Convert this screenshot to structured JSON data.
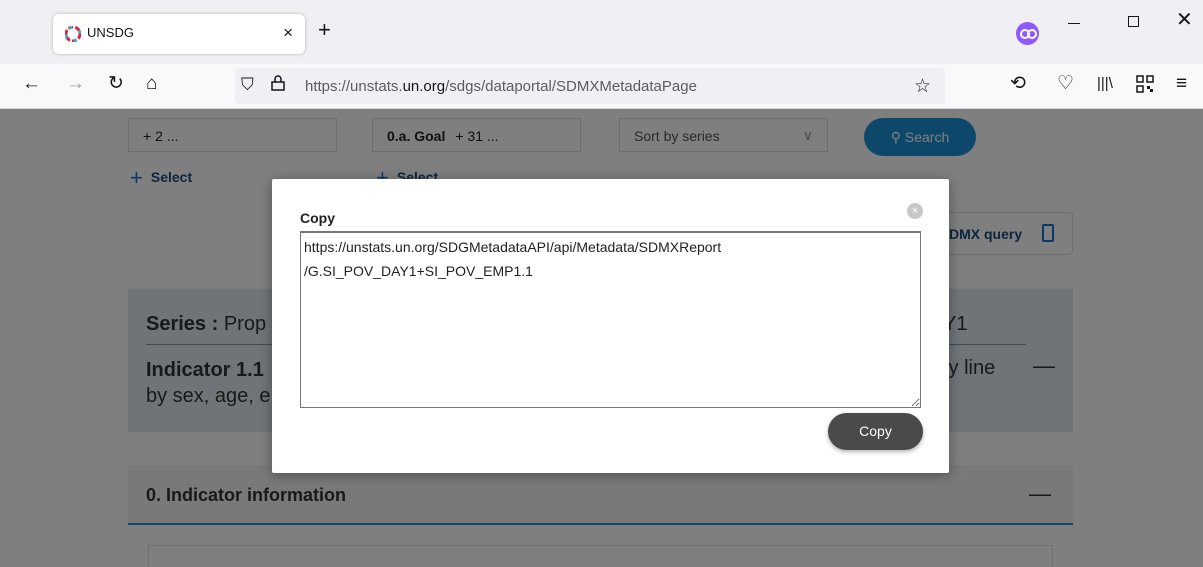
{
  "browser": {
    "tab": {
      "title": "UNSDG",
      "close": "×"
    },
    "new_tab": "+",
    "window": {
      "close": "✕"
    },
    "nav": {
      "back": "←",
      "forward": "→",
      "reload": "↻",
      "home": "⌂"
    },
    "url": {
      "prefix": "https://unstats.",
      "domain": "un.org",
      "path": "/sdgs/dataportal/SDMXMetadataPage"
    },
    "toolbar_icons": [
      "bookmark-star-icon",
      "history-icon",
      "pocket-icon",
      "library-icon",
      "qr-code-icon",
      "menu-icon"
    ]
  },
  "filters": {
    "box1": "+ 2 ...",
    "box2_goal": "0.a. Goal",
    "box2_more": "+ 31 ...",
    "sort": "Sort by series",
    "select_label_1": "Select",
    "select_label_2": "Select",
    "search_label": "Search"
  },
  "sdmx_query": {
    "label": "DMX query"
  },
  "series": {
    "label": "Series :",
    "text_left": "Prop",
    "text_right": "Y1",
    "indicator_label": "Indicator 1.1",
    "indicator_line2": "by sex, age, e",
    "indicator_right": "ty line"
  },
  "info": {
    "title": "0. Indicator information"
  },
  "modal": {
    "title": "Copy",
    "close": "×",
    "textarea_value": "https://unstats.un.org/SDGMetadataAPI/api/Metadata/SDMXReport\n/G.SI_POV_DAY1+SI_POV_EMP1.1",
    "copy_button": "Copy"
  },
  "colors": {
    "accent": "#1a8fd5",
    "panel": "#dde9f1",
    "overlay": "rgba(0,0,0,0.5)",
    "private_icon": "#9059ff"
  }
}
